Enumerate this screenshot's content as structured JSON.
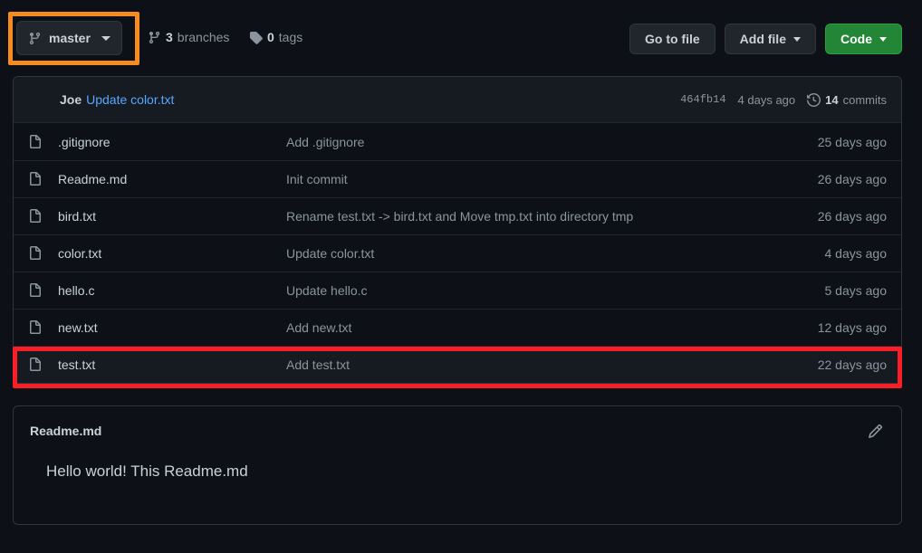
{
  "branch_selector": {
    "label": "master",
    "icon": "git-branch-icon",
    "caret": "chevron-down-icon"
  },
  "repo_meta": {
    "branches": {
      "count": "3",
      "label": "branches",
      "icon": "git-branch-icon"
    },
    "tags": {
      "count": "0",
      "label": "tags",
      "icon": "tag-icon"
    }
  },
  "actions": {
    "go_to_file": "Go to file",
    "add_file": "Add file",
    "code": "Code"
  },
  "latest_commit": {
    "author": "Joe",
    "message": "Update color.txt",
    "sha": "464fb14",
    "time": "4 days ago",
    "commits_count": "14",
    "commits_label": "commits",
    "history_icon": "history-clock-icon"
  },
  "files": [
    {
      "icon": "file-icon",
      "name": ".gitignore",
      "message": "Add .gitignore",
      "time": "25 days ago",
      "highlighted": false
    },
    {
      "icon": "file-icon",
      "name": "Readme.md",
      "message": "Init commit",
      "time": "26 days ago",
      "highlighted": false
    },
    {
      "icon": "file-icon",
      "name": "bird.txt",
      "message": "Rename test.txt -> bird.txt and Move tmp.txt into directory tmp",
      "time": "26 days ago",
      "highlighted": false
    },
    {
      "icon": "file-icon",
      "name": "color.txt",
      "message": "Update color.txt",
      "time": "4 days ago",
      "highlighted": false
    },
    {
      "icon": "file-icon",
      "name": "hello.c",
      "message": "Update hello.c",
      "time": "5 days ago",
      "highlighted": false
    },
    {
      "icon": "file-icon",
      "name": "new.txt",
      "message": "Add new.txt",
      "time": "12 days ago",
      "highlighted": false
    },
    {
      "icon": "file-icon",
      "name": "test.txt",
      "message": "Add test.txt",
      "time": "22 days ago",
      "highlighted": true
    }
  ],
  "readme": {
    "title": "Readme.md",
    "edit_icon": "pencil-icon",
    "body": "Hello world! This Readme.md"
  },
  "annotations": {
    "branch_box_color": "#f68b1f",
    "test_row_box_color": "#fa1f27"
  },
  "colors": {
    "page_background": "#0d1117",
    "card_background": "#0d1117",
    "card_border": "#30363d",
    "header_row_background": "#161b22",
    "link_blue": "#58a6ff",
    "text_primary": "#c9d1d9",
    "text_muted": "#8b949e",
    "green_button": "#238636"
  }
}
